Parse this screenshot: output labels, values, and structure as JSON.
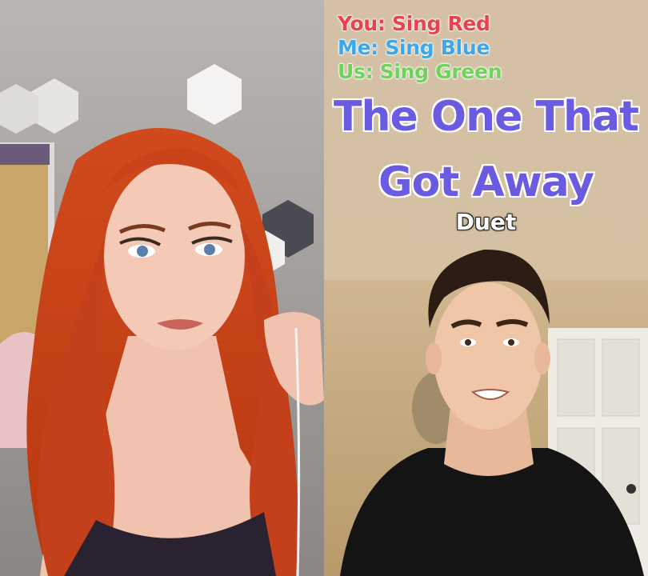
{
  "overlay": {
    "instructions": {
      "you": "You: Sing Red",
      "me": "Me: Sing Blue",
      "us": "Us: Sing Green"
    },
    "title_lines": [
      "The One That",
      "Got Away"
    ],
    "subtitle": "Duet"
  },
  "colors": {
    "you": "#e8434d",
    "me": "#3aa8ea",
    "us": "#6fd35a",
    "title": "#6a5be0"
  }
}
